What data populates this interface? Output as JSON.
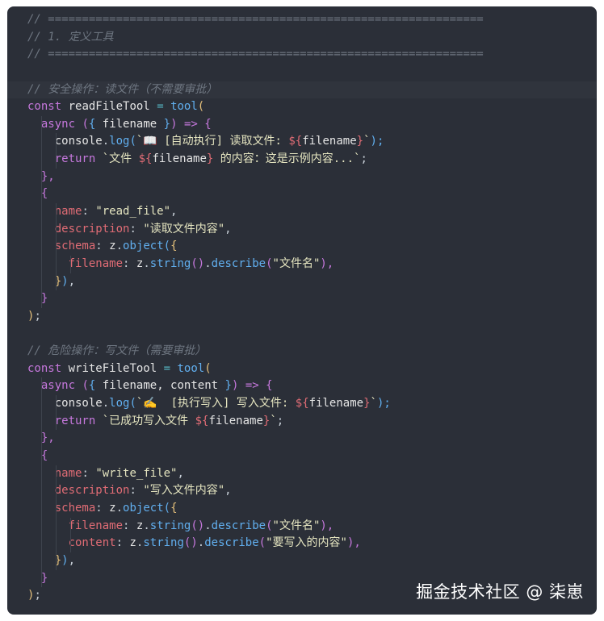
{
  "code": {
    "l1": "// ================================================================",
    "l2": "// 1. 定义工具",
    "l3": "// ================================================================",
    "l5": "// 安全操作：读文件（不需要审批）",
    "l6_const": "const",
    "l6_name": "readFileTool",
    "l6_eq": "=",
    "l6_fn": "tool",
    "l6_paren": "(",
    "l7_async": "async",
    "l7_a": "(",
    "l7_b": "{",
    "l7_param": "filename",
    "l7_c": "}",
    "l7_d": ")",
    "l7_arrow": "=>",
    "l7_e": "{",
    "l8_obj": "console",
    "l8_dot": ".",
    "l8_fn": "log",
    "l8_p1": "(",
    "l8_t1": "`📖 [自动执行] 读取文件: ",
    "l8_i1": "${",
    "l8_var": "filename",
    "l8_i2": "}",
    "l8_t2": "`",
    "l8_p2": ");",
    "l9_ret": "return",
    "l9_t1": "`文件 ",
    "l9_i1": "${",
    "l9_var": "filename",
    "l9_i2": "}",
    "l9_t2": " 的内容：这是示例内容...`",
    "l9_end": ";",
    "l10": "},",
    "l11": "{",
    "l12_key": "name",
    "l12_colon": ":",
    "l12_val": "\"read_file\"",
    "l12_comma": ",",
    "l13_key": "description",
    "l13_colon": ":",
    "l13_val": "\"读取文件内容\"",
    "l13_comma": ",",
    "l14_key": "schema",
    "l14_colon": ":",
    "l14_obj": "z",
    "l14_dot": ".",
    "l14_fn": "object",
    "l14_p": "(",
    "l14_b": "{",
    "l15_key": "filename",
    "l15_colon": ":",
    "l15_obj": "z",
    "l15_d1": ".",
    "l15_fn1": "string",
    "l15_p1": "()",
    "l15_d2": ".",
    "l15_fn2": "describe",
    "l15_p2": "(",
    "l15_val": "\"文件名\"",
    "l15_p3": "),",
    "l16_b": "}",
    "l16_p": ")",
    "l16_c": ",",
    "l17": "}",
    "l18_p": ")",
    "l18_s": ";",
    "l20": "// 危险操作：写文件（需要审批）",
    "l21_const": "const",
    "l21_name": "writeFileTool",
    "l21_eq": "=",
    "l21_fn": "tool",
    "l21_paren": "(",
    "l22_async": "async",
    "l22_a": "(",
    "l22_b": "{",
    "l22_param": "filename, content",
    "l22_c": "}",
    "l22_d": ")",
    "l22_arrow": "=>",
    "l22_e": "{",
    "l23_obj": "console",
    "l23_dot": ".",
    "l23_fn": "log",
    "l23_p1": "(",
    "l23_t1": "`✍️  [执行写入] 写入文件: ",
    "l23_i1": "${",
    "l23_var": "filename",
    "l23_i2": "}",
    "l23_t2": "`",
    "l23_p2": ");",
    "l24_ret": "return",
    "l24_t1": "`已成功写入文件 ",
    "l24_i1": "${",
    "l24_var": "filename",
    "l24_i2": "}",
    "l24_t2": "`",
    "l24_end": ";",
    "l25": "},",
    "l26": "{",
    "l27_key": "name",
    "l27_colon": ":",
    "l27_val": "\"write_file\"",
    "l27_comma": ",",
    "l28_key": "description",
    "l28_colon": ":",
    "l28_val": "\"写入文件内容\"",
    "l28_comma": ",",
    "l29_key": "schema",
    "l29_colon": ":",
    "l29_obj": "z",
    "l29_dot": ".",
    "l29_fn": "object",
    "l29_p": "(",
    "l29_b": "{",
    "l30_key": "filename",
    "l30_colon": ":",
    "l30_obj": "z",
    "l30_d1": ".",
    "l30_fn1": "string",
    "l30_p1": "()",
    "l30_d2": ".",
    "l30_fn2": "describe",
    "l30_p2": "(",
    "l30_val": "\"文件名\"",
    "l30_p3": "),",
    "l31_key": "content",
    "l31_colon": ":",
    "l31_obj": "z",
    "l31_d1": ".",
    "l31_fn1": "string",
    "l31_p1": "()",
    "l31_d2": ".",
    "l31_fn2": "describe",
    "l31_p2": "(",
    "l31_val": "\"要写入的内容\"",
    "l31_p3": "),",
    "l32_b": "}",
    "l32_p": ")",
    "l32_c": ",",
    "l33": "}",
    "l34_p": ")",
    "l34_s": ";"
  },
  "watermark": "掘金技术社区 @ 柒崽",
  "colors": {
    "background": "#2b2f38",
    "comment": "#6e7681",
    "keyword": "#c678dd",
    "function": "#61afef",
    "property": "#e06c75",
    "string": "#e5e5c0"
  }
}
